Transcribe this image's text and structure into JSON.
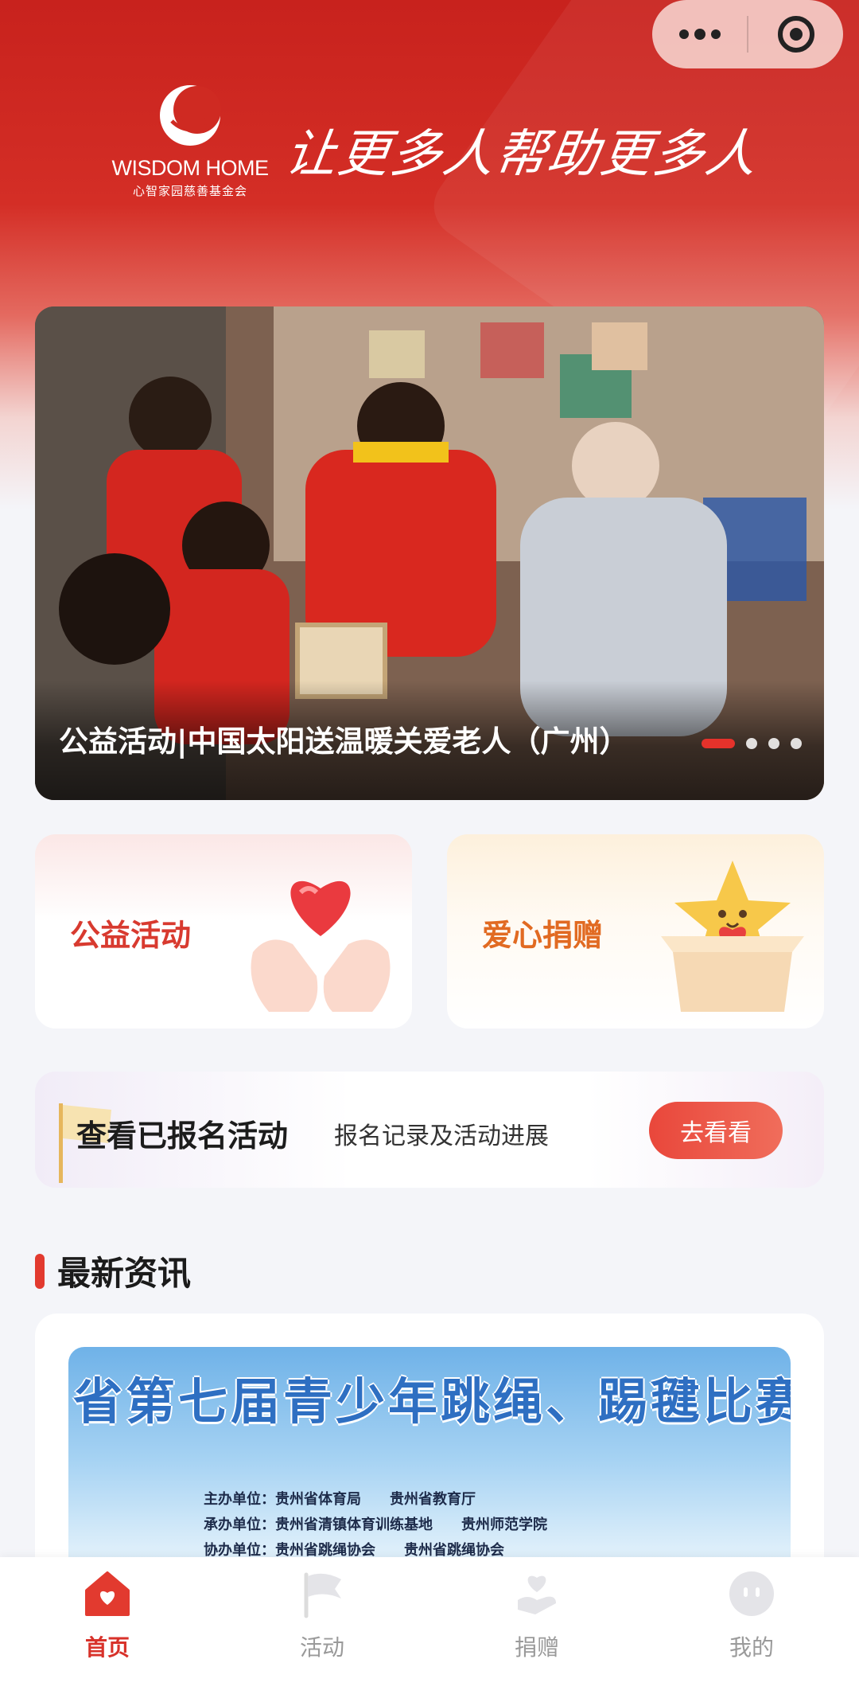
{
  "header": {
    "brand_name": "WISDOM HOME",
    "brand_sub": "心智家园慈善基金会",
    "slogan": "让更多人帮助更多人"
  },
  "banner": {
    "caption": "公益活动|中国太阳送温暖关爱老人（广州）",
    "slide_count": 4,
    "active_slide": 1
  },
  "entries": {
    "activity_label": "公益活动",
    "donate_label": "爱心捐赠"
  },
  "registered": {
    "title": "查看已报名活动",
    "description": "报名记录及活动进展",
    "button": "去看看"
  },
  "news": {
    "section_title": "最新资讯",
    "image_headline": "省第七届青少年跳绳、踢毽比赛",
    "image_lines": [
      "主办单位：贵州省体育局　　贵州省教育厅",
      "承办单位：贵州省清镇体育训练基地　　贵州师范学院",
      "协办单位：贵州省跳绳协会　　贵州省跳绳协会"
    ]
  },
  "tabbar": {
    "items": [
      {
        "label": "首页",
        "icon": "home-heart-icon"
      },
      {
        "label": "活动",
        "icon": "flag-icon"
      },
      {
        "label": "捐赠",
        "icon": "heart-hand-icon"
      },
      {
        "label": "我的",
        "icon": "profile-face-icon"
      }
    ]
  },
  "colors": {
    "brand_red": "#d42e26",
    "accent_orange": "#e16a22",
    "inactive_gray": "#9a9a9a"
  }
}
